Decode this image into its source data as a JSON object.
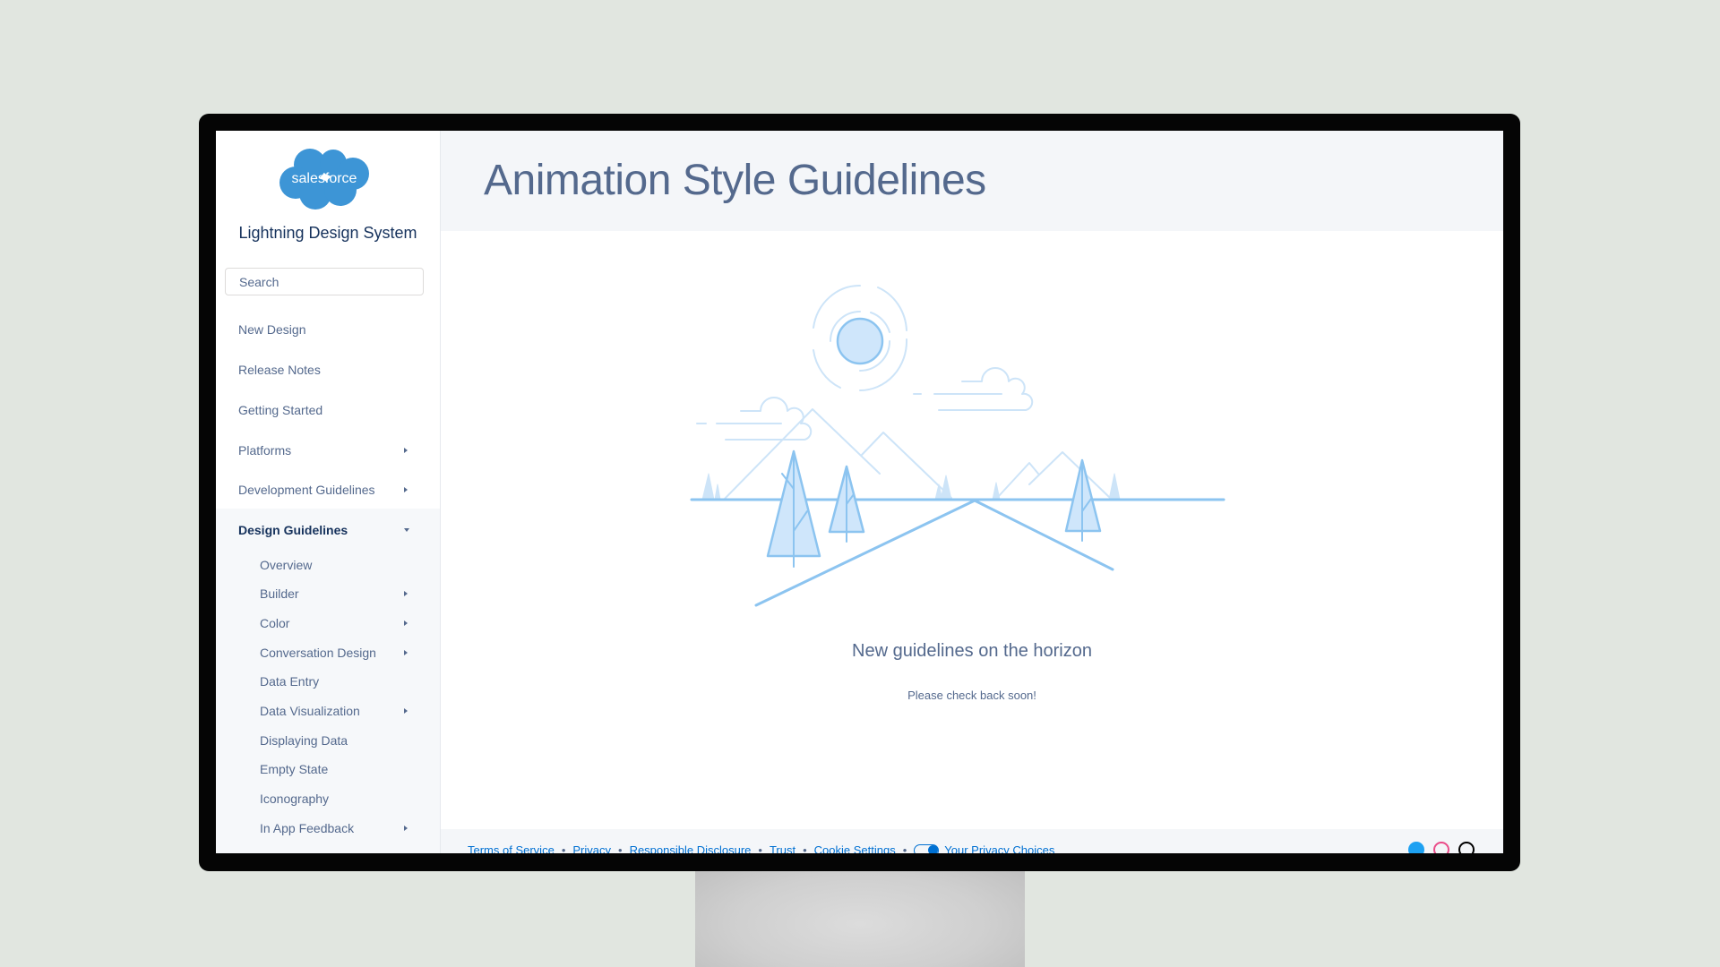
{
  "sidebar": {
    "logo_text": "salesforce",
    "brand": "Lightning Design System",
    "search_placeholder": "Search",
    "items": [
      {
        "label": "New Design",
        "chevron": "none"
      },
      {
        "label": "Release Notes",
        "chevron": "none"
      },
      {
        "label": "Getting Started",
        "chevron": "none"
      },
      {
        "label": "Platforms",
        "chevron": "right"
      },
      {
        "label": "Development Guidelines",
        "chevron": "right"
      },
      {
        "label": "Design Guidelines",
        "chevron": "down",
        "active": true
      }
    ],
    "sub_items": [
      {
        "label": "Overview",
        "chevron": "none"
      },
      {
        "label": "Builder",
        "chevron": "right"
      },
      {
        "label": "Color",
        "chevron": "right"
      },
      {
        "label": "Conversation Design",
        "chevron": "right"
      },
      {
        "label": "Data Entry",
        "chevron": "none"
      },
      {
        "label": "Data Visualization",
        "chevron": "right"
      },
      {
        "label": "Displaying Data",
        "chevron": "none"
      },
      {
        "label": "Empty State",
        "chevron": "none"
      },
      {
        "label": "Iconography",
        "chevron": "none"
      },
      {
        "label": "In App Feedback",
        "chevron": "right"
      }
    ]
  },
  "main": {
    "title": "Animation Style Guidelines",
    "empty_state": {
      "illustration": "mountains-horizon-illustration",
      "heading": "New guidelines on the horizon",
      "message": "Please check back soon!"
    }
  },
  "footer": {
    "links": [
      "Terms of Service",
      "Privacy",
      "Responsible Disclosure",
      "Trust",
      "Cookie Settings",
      "Your Privacy Choices"
    ],
    "social_icons": [
      "twitter-icon",
      "dribbble-icon",
      "github-icon"
    ]
  },
  "colors": {
    "brand_blue": "#00a1e0",
    "text": "#54698d",
    "text_dark": "#16325c",
    "link": "#0070d2",
    "illustration": "#8cc4f0"
  }
}
